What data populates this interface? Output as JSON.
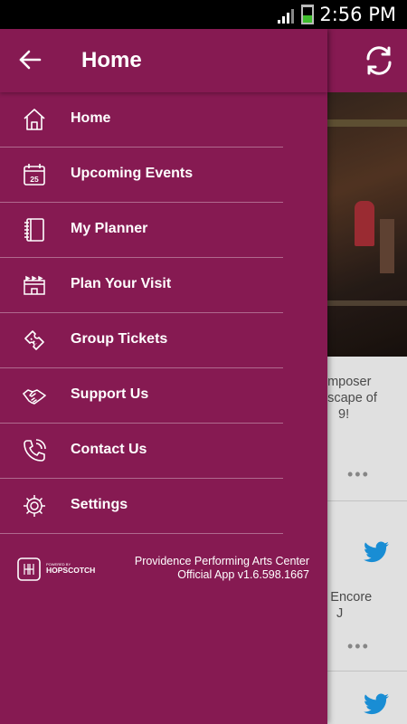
{
  "status_bar": {
    "time": "2:56 PM"
  },
  "drawer": {
    "title": "Home",
    "items": [
      {
        "label": "Home",
        "icon": "home-icon"
      },
      {
        "label": "Upcoming Events",
        "icon": "calendar-icon",
        "icon_text": "25"
      },
      {
        "label": "My Planner",
        "icon": "planner-icon"
      },
      {
        "label": "Plan Your Visit",
        "icon": "venue-icon"
      },
      {
        "label": "Group Tickets",
        "icon": "ticket-icon"
      },
      {
        "label": "Support Us",
        "icon": "handshake-icon"
      },
      {
        "label": "Contact Us",
        "icon": "phone-icon"
      },
      {
        "label": "Settings",
        "icon": "gear-icon"
      }
    ],
    "footer": {
      "logo_small": "POWERED BY",
      "logo_text": "HOPSCOTCH",
      "line1": "Providence Performing Arts Center",
      "line2": "Official App v1.6.598.1667"
    }
  },
  "background": {
    "card1_lines": [
      "omposer",
      "dscape of",
      "9!"
    ],
    "card2_lines": [
      "s Encore",
      "J"
    ],
    "more": "•••"
  },
  "colors": {
    "brand": "#861a52",
    "twitter": "#1da1f2"
  }
}
